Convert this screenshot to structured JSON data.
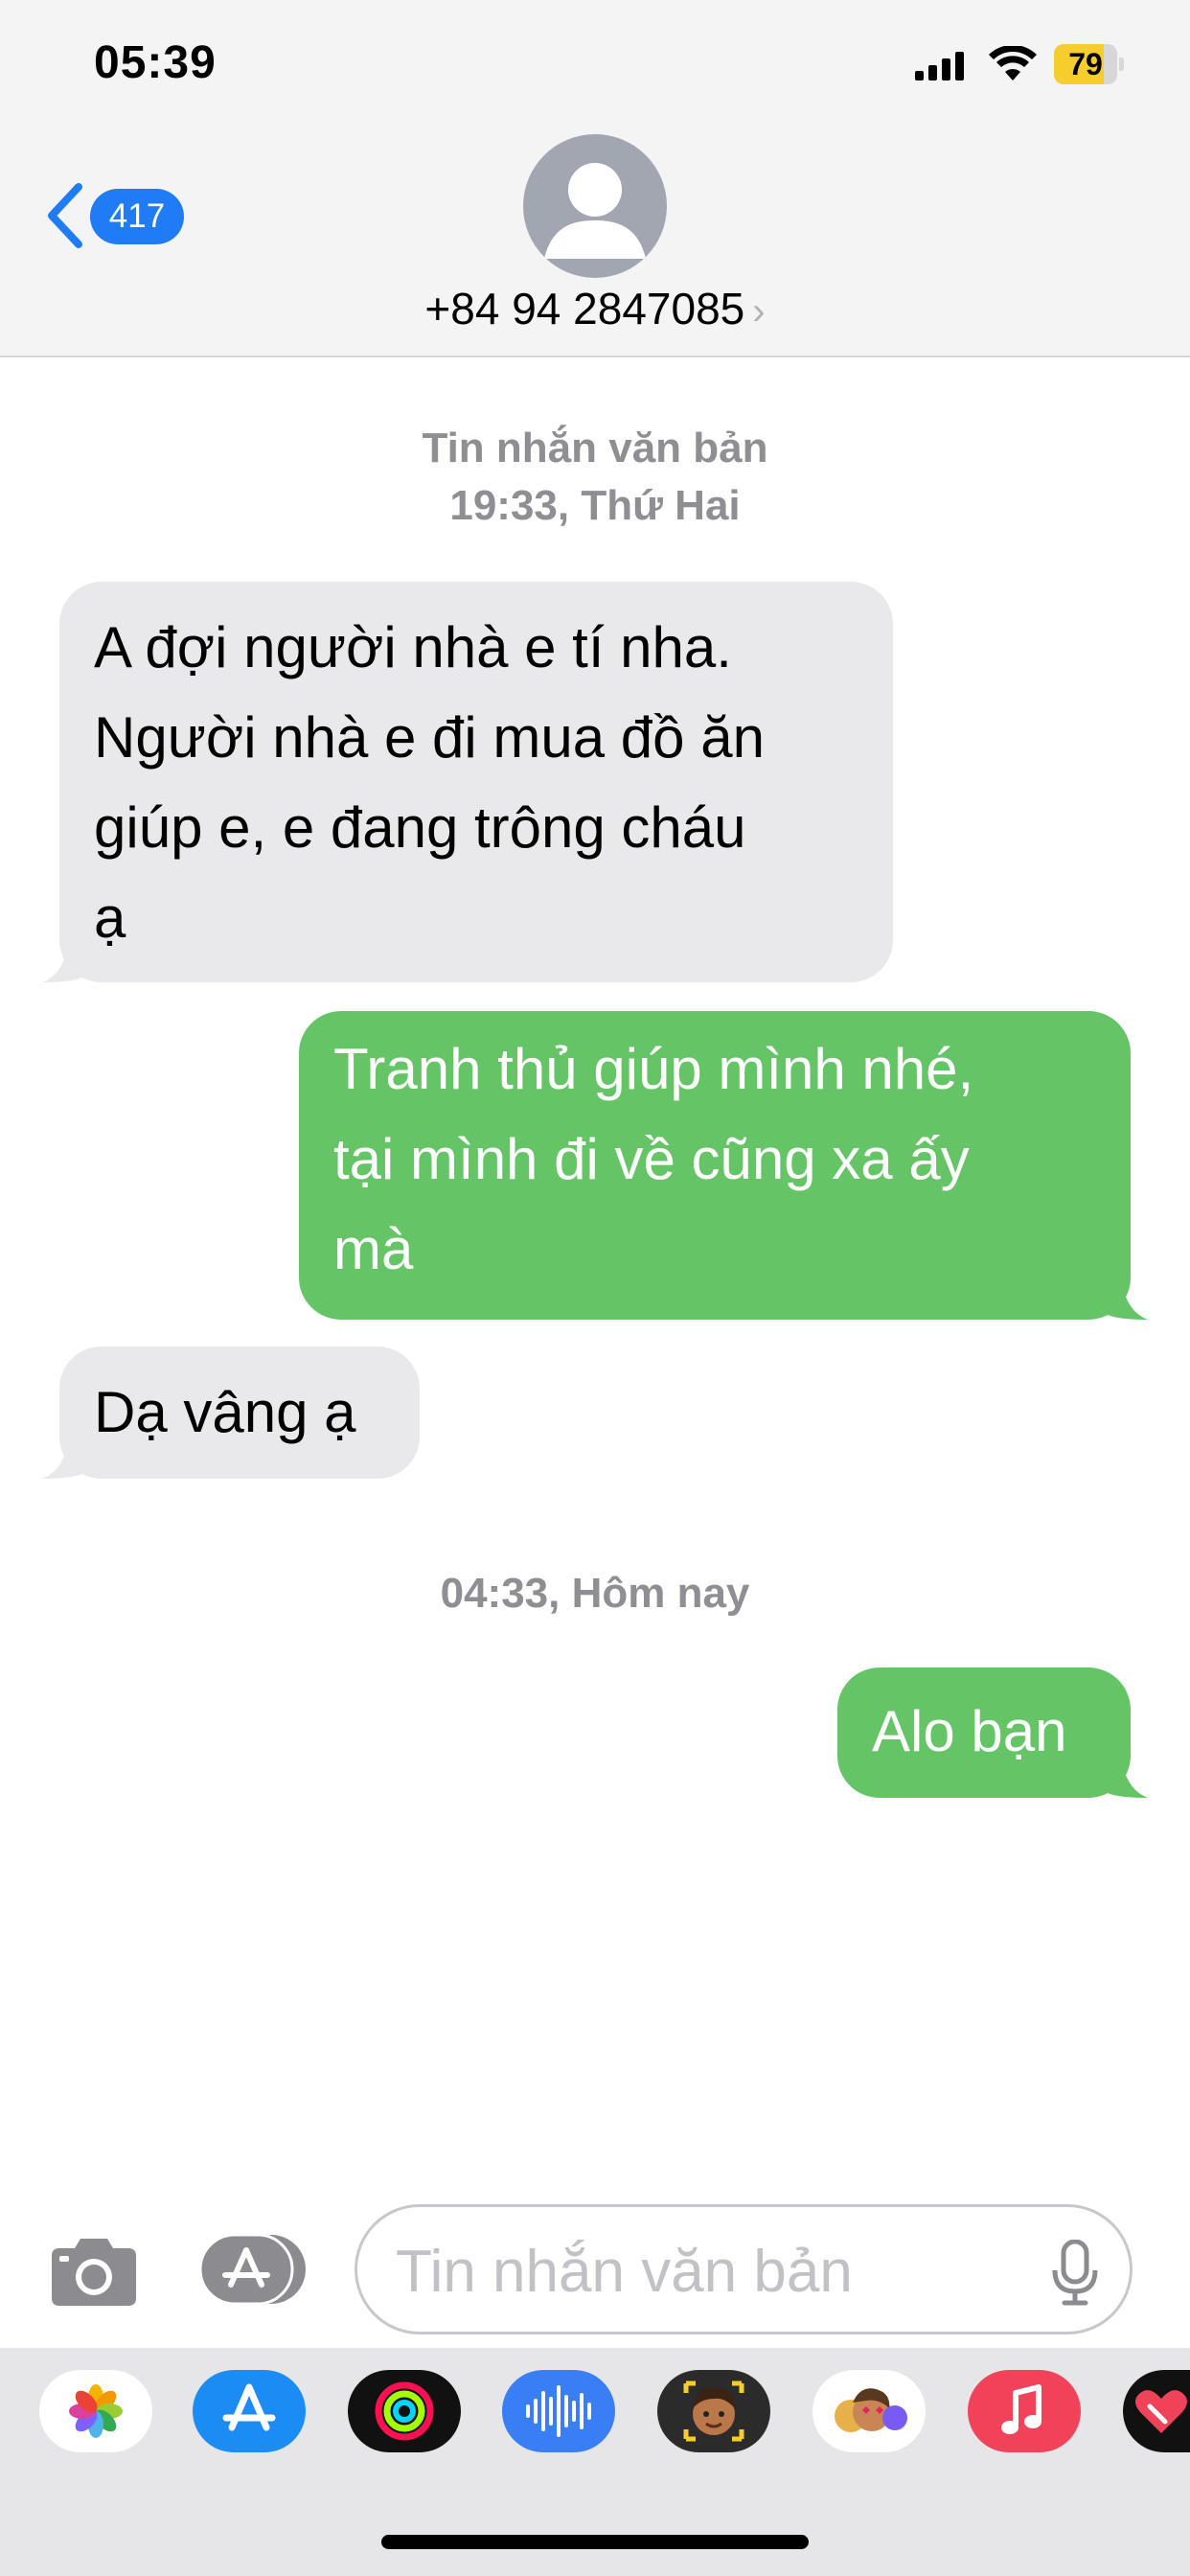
{
  "status_bar": {
    "time": "05:39",
    "battery_level": "79",
    "battery_fraction": 0.79,
    "battery_color": "#f7cc2d"
  },
  "header": {
    "back_badge_count": "417",
    "contact_name": "+84 94 2847085",
    "accent_color": "#1f7cf5"
  },
  "conversation": {
    "header_label": "Tin nhắn văn bản",
    "header_time": "19:33, Thứ Hai",
    "messages": [
      {
        "direction": "incoming",
        "text": "A đợi người nhà e tí nha.\nNgười nhà e đi mua đồ ăn\ngiúp e, e đang trông cháu\nạ"
      },
      {
        "direction": "outgoing",
        "text": " Tranh thủ giúp mình nhé,\ntại mình đi về cũng xa ấy\nmà"
      },
      {
        "direction": "incoming",
        "text": "Dạ vâng ạ"
      },
      {
        "direction": "outgoing",
        "text": "Alo bạn"
      }
    ],
    "separator_time": "04:33, Hôm nay",
    "incoming_color": "#e9e9eb",
    "outgoing_color": "#65c466"
  },
  "composer": {
    "placeholder": "Tin nhắn văn bản",
    "value": ""
  },
  "icons": {
    "camera": "camera-icon",
    "app_store": "app-store-icon",
    "microphone": "microphone-icon"
  },
  "app_drawer": {
    "apps": [
      "photos",
      "app-store",
      "activity",
      "audio-message",
      "memoji",
      "animoji-stickers",
      "music",
      "digital-touch"
    ]
  }
}
